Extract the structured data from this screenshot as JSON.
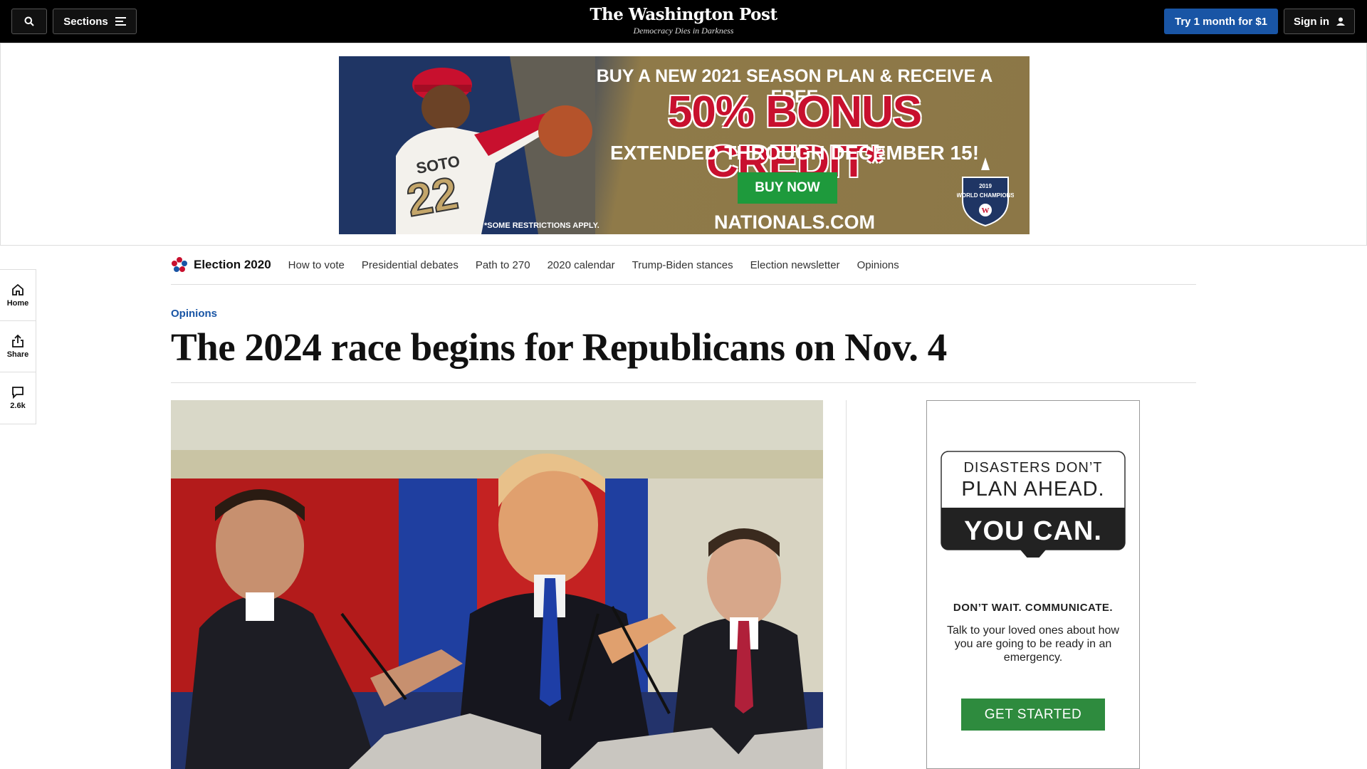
{
  "topbar": {
    "sections_label": "Sections",
    "masthead": "The Washington Post",
    "tagline": "Democracy Dies in Darkness",
    "trial_label": "Try 1 month for $1",
    "signin_label": "Sign in"
  },
  "top_ad": {
    "line1": "BUY A NEW 2021 SEASON PLAN & RECEIVE A FREE",
    "line2": "50% BONUS CREDIT*",
    "line3": "EXTENDED THROUGH DECEMBER 15!",
    "button": "BUY NOW",
    "restrictions": "*SOME RESTRICTIONS APPLY.",
    "site": "NATIONALS.COM",
    "badge_year": "2019",
    "badge_text": "WORLD CHAMPIONS",
    "jersey_name": "SOTO",
    "jersey_number": "22"
  },
  "side_rail": {
    "home": "Home",
    "share": "Share",
    "comments": "2.6k"
  },
  "election_nav": {
    "brand": "Election 2020",
    "links": [
      "How to vote",
      "Presidential debates",
      "Path to 270",
      "2020 calendar",
      "Trump-Biden stances",
      "Election newsletter",
      "Opinions"
    ]
  },
  "article": {
    "kicker": "Opinions",
    "headline": "The 2024 race begins for Republicans on Nov. 4"
  },
  "side_ad": {
    "line1": "DISASTERS DON’T",
    "line2": "PLAN AHEAD.",
    "line3": "YOU CAN.",
    "heading": "DON’T WAIT. COMMUNICATE.",
    "body": "Talk to your loved ones about how you are going to be ready in an emergency.",
    "button": "GET STARTED"
  },
  "colors": {
    "accent_blue": "#1955a5",
    "ad_green": "#2e8b3e",
    "nats_red": "#c8102e"
  }
}
